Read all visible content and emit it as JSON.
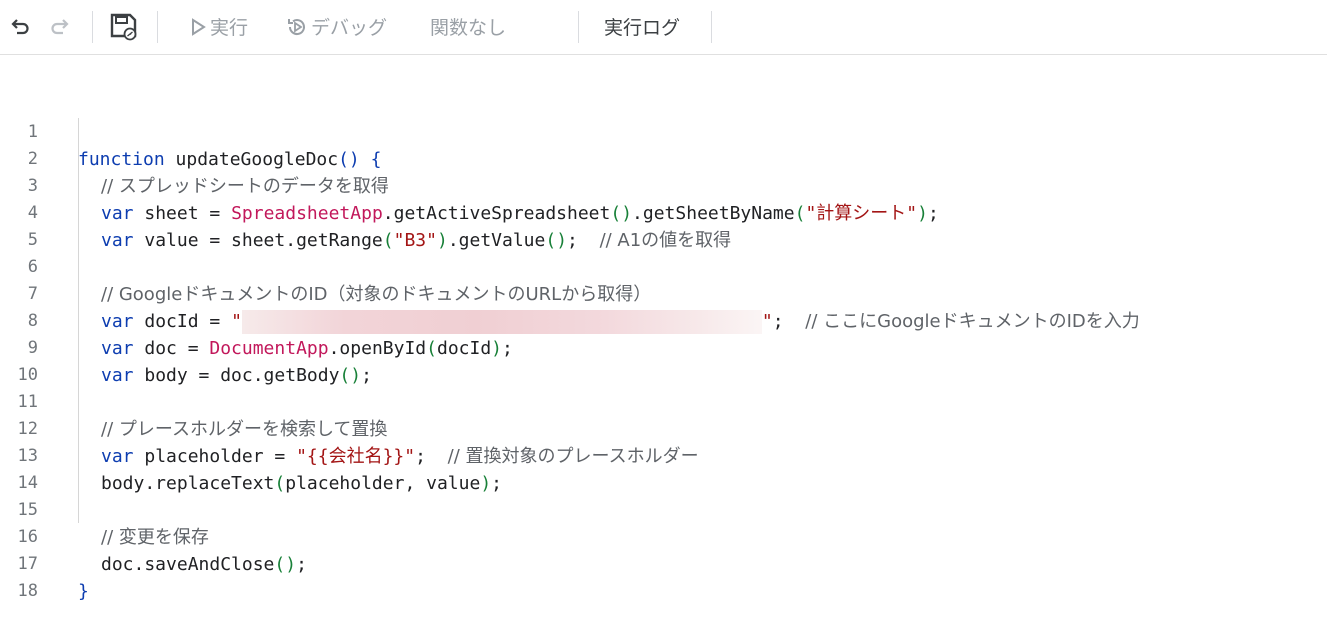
{
  "toolbar": {
    "undo_icon": "undo-icon",
    "redo_icon": "redo-icon",
    "save_icon": "save-icon",
    "run_label": "実行",
    "debug_label": "デバッグ",
    "function_label": "関数なし",
    "log_label": "実行ログ"
  },
  "editor": {
    "lines": [
      {
        "n": "1",
        "t": [
          "function",
          " updateGoogleDoc",
          "()",
          " {"
        ]
      },
      {
        "n": "2",
        "t": [
          "// スプレッドシートのデータを取得"
        ]
      },
      {
        "n": "3",
        "t": [
          "var",
          " sheet = ",
          "SpreadsheetApp",
          ".getActiveSpreadsheet",
          "()",
          ".getSheetByName",
          "(",
          "\"計算シート\"",
          ")",
          ";"
        ]
      },
      {
        "n": "4",
        "t": [
          "var",
          " value = sheet.getRange",
          "(",
          "\"B3\"",
          ")",
          ".getValue",
          "()",
          ";  ",
          "// A1の値を取得"
        ]
      },
      {
        "n": "5",
        "t": []
      },
      {
        "n": "6",
        "t": [
          "// GoogleドキュメントのID（対象のドキュメントのURLから取得）"
        ]
      },
      {
        "n": "7",
        "t": [
          "var",
          " docId = ",
          "\"",
          "\"",
          ";  ",
          "// ここにGoogleドキュメントのIDを入力"
        ]
      },
      {
        "n": "8",
        "t": [
          "var",
          " doc = ",
          "DocumentApp",
          ".openById",
          "(",
          "docId",
          ")",
          ";"
        ]
      },
      {
        "n": "9",
        "t": [
          "var",
          " body = doc.getBody",
          "()",
          ";"
        ]
      },
      {
        "n": "10",
        "t": []
      },
      {
        "n": "11",
        "t": [
          "// プレースホルダーを検索して置換"
        ]
      },
      {
        "n": "12",
        "t": [
          "var",
          " placeholder = ",
          "\"{{会社名}}\"",
          ";  ",
          "// 置換対象のプレースホルダー"
        ]
      },
      {
        "n": "13",
        "t": [
          "body.replaceText",
          "(",
          "placeholder, value",
          ")",
          ";"
        ]
      },
      {
        "n": "14",
        "t": []
      },
      {
        "n": "15",
        "t": [
          "// 変更を保存"
        ]
      },
      {
        "n": "16",
        "t": [
          "doc.saveAndClose",
          "()",
          ";"
        ]
      },
      {
        "n": "17",
        "t": [
          "}"
        ]
      },
      {
        "n": "18",
        "t": []
      }
    ]
  }
}
